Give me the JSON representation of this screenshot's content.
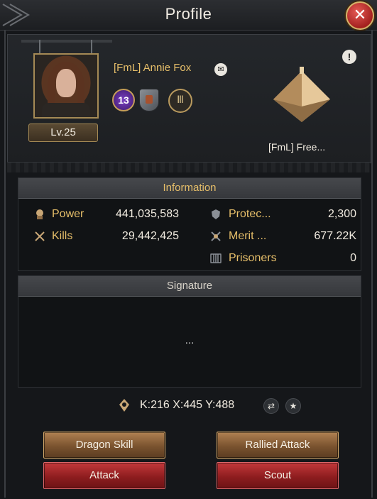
{
  "header": {
    "title": "Profile"
  },
  "player": {
    "name": "[FmL] Annie Fox",
    "level": "Lv.25",
    "badge_level": "13",
    "city_name": "[FmL] Free..."
  },
  "information": {
    "heading": "Information",
    "stats_left": [
      {
        "label": "Power",
        "value": "441,035,583",
        "icon": "power-icon"
      },
      {
        "label": "Kills",
        "value": "29,442,425",
        "icon": "kills-icon"
      }
    ],
    "stats_right": [
      {
        "label": "Protec...",
        "value": "2,300",
        "icon": "protection-icon"
      },
      {
        "label": "Merit ...",
        "value": "677.22K",
        "icon": "merit-icon"
      },
      {
        "label": "Prisoners",
        "value": "0",
        "icon": "prisoners-icon"
      }
    ]
  },
  "signature": {
    "heading": "Signature",
    "text": "..."
  },
  "location": {
    "coords": "K:216 X:445 Y:488"
  },
  "buttons": {
    "dragon_skill": "Dragon Skill",
    "rallied_attack": "Rallied Attack",
    "attack": "Attack",
    "scout": "Scout"
  },
  "icons": {
    "close": "✕",
    "mail": "✉",
    "info": "!",
    "pillar": "Ⅲ",
    "share": "⇄",
    "star": "★"
  },
  "colors": {
    "accent_gold": "#e7bf6a",
    "button_gold": "#7a532f",
    "button_red": "#8e1d1f"
  }
}
